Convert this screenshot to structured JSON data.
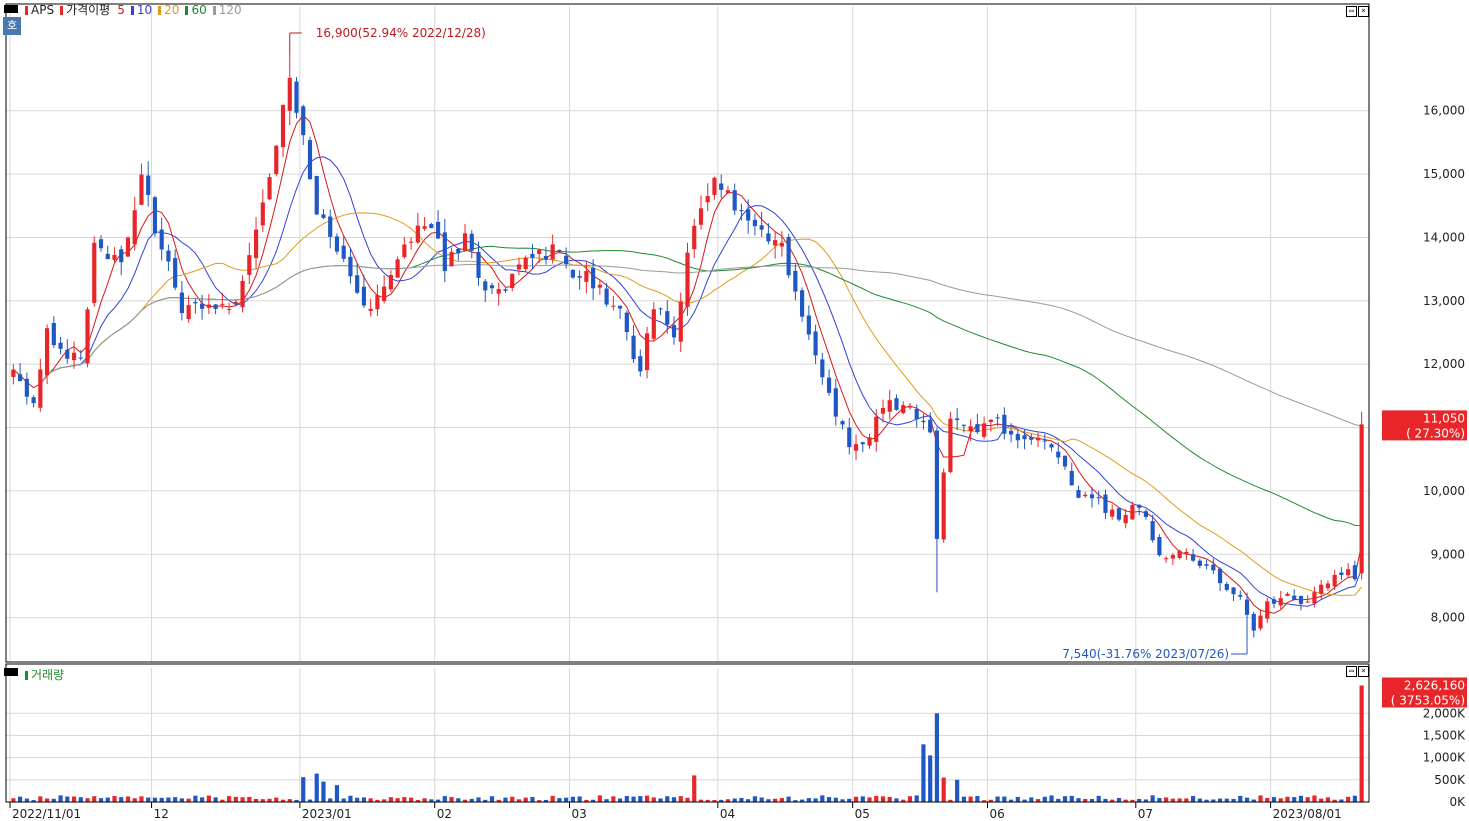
{
  "legend_price": {
    "ticker": "APS",
    "label": "가격이평",
    "ma5": "5",
    "ma10": "10",
    "ma20": "20",
    "ma60": "60",
    "ma120": "120"
  },
  "legend_volume": {
    "label": "거래량"
  },
  "side_tag": "호",
  "annotations": {
    "high": "16,900(52.94% 2022/12/28)",
    "low": "7,540(-31.76% 2023/07/26)"
  },
  "price_badge": {
    "price": "11,050",
    "change": "( 27.30%)"
  },
  "volume_badge": {
    "volume": "2,626,160",
    "change": "( 3753.05%)"
  },
  "colors": {
    "up": "#e8262a",
    "down": "#1f57c4",
    "ma5": "#d81818",
    "ma10": "#3340d8",
    "ma20": "#e39a1a",
    "ma60": "#1e8a2e",
    "ma120": "#9a9a9a",
    "grid": "#d8d8d8"
  },
  "chart_data": {
    "type": "candlestick",
    "x_axis_labels": [
      "2022/11/01",
      "12",
      "2023/01",
      "02",
      "03",
      "04",
      "05",
      "06",
      "07",
      "2023/08/01"
    ],
    "price_axis": {
      "ticks": [
        "8,000",
        "9,000",
        "10,000",
        "11,000",
        "12,000",
        "13,000",
        "14,000",
        "15,000",
        "16,000"
      ],
      "range": [
        7300,
        17400
      ]
    },
    "volume_axis": {
      "ticks": [
        "0K",
        "500K",
        "1,000K",
        "1,500K",
        "2,000K"
      ],
      "range": [
        0,
        2750000
      ]
    },
    "month_starts": [
      {
        "label": "2022/11/01",
        "index": 0
      },
      {
        "label": "12",
        "index": 21
      },
      {
        "label": "2023/01",
        "index": 43
      },
      {
        "label": "02",
        "index": 63
      },
      {
        "label": "03",
        "index": 83
      },
      {
        "label": "04",
        "index": 105
      },
      {
        "label": "05",
        "index": 125
      },
      {
        "label": "06",
        "index": 145
      },
      {
        "label": "07",
        "index": 167
      },
      {
        "label": "2023/08/01",
        "index": 187
      }
    ],
    "close_anchors": [
      [
        0,
        11800
      ],
      [
        3,
        11400
      ],
      [
        5,
        12500
      ],
      [
        10,
        12000
      ],
      [
        12,
        13900
      ],
      [
        16,
        13500
      ],
      [
        19,
        14900
      ],
      [
        22,
        13800
      ],
      [
        25,
        12900
      ],
      [
        28,
        13000
      ],
      [
        33,
        13000
      ],
      [
        37,
        14500
      ],
      [
        41,
        16500
      ],
      [
        42,
        16000
      ],
      [
        45,
        14500
      ],
      [
        48,
        13900
      ],
      [
        51,
        13100
      ],
      [
        53,
        12900
      ],
      [
        56,
        13500
      ],
      [
        59,
        14000
      ],
      [
        62,
        14200
      ],
      [
        64,
        13600
      ],
      [
        67,
        14000
      ],
      [
        70,
        13100
      ],
      [
        73,
        13200
      ],
      [
        77,
        13700
      ],
      [
        80,
        13800
      ],
      [
        83,
        13500
      ],
      [
        86,
        13300
      ],
      [
        90,
        12800
      ],
      [
        93,
        11900
      ],
      [
        95,
        12900
      ],
      [
        98,
        12500
      ],
      [
        101,
        14200
      ],
      [
        104,
        14900
      ],
      [
        107,
        14500
      ],
      [
        110,
        14300
      ],
      [
        114,
        13800
      ],
      [
        117,
        12800
      ],
      [
        121,
        11500
      ],
      [
        124,
        10700
      ],
      [
        127,
        10900
      ],
      [
        130,
        11400
      ],
      [
        133,
        11300
      ],
      [
        136,
        11000
      ],
      [
        137,
        9200
      ],
      [
        139,
        11200
      ],
      [
        142,
        11000
      ],
      [
        145,
        11100
      ],
      [
        149,
        10900
      ],
      [
        152,
        10800
      ],
      [
        155,
        10500
      ],
      [
        158,
        9900
      ],
      [
        161,
        9800
      ],
      [
        164,
        9600
      ],
      [
        167,
        9800
      ],
      [
        170,
        9000
      ],
      [
        174,
        9000
      ],
      [
        178,
        8700
      ],
      [
        182,
        8300
      ],
      [
        184,
        7800
      ],
      [
        186,
        8200
      ],
      [
        189,
        8300
      ],
      [
        192,
        8200
      ],
      [
        195,
        8600
      ],
      [
        198,
        8700
      ],
      [
        199,
        8680
      ],
      [
        200,
        11050
      ]
    ],
    "high": {
      "value": 16900,
      "date": "2022/12/28",
      "change_pct": 52.94
    },
    "low": {
      "value": 7540,
      "date": "2023/07/26",
      "change_pct": -31.76
    },
    "last_close": 11050,
    "last_change_pct": 27.3,
    "last_volume": 2626160,
    "last_volume_change_pct": 3753.05,
    "volume_spikes": [
      [
        43,
        560000
      ],
      [
        45,
        640000
      ],
      [
        46,
        460000
      ],
      [
        48,
        380000
      ],
      [
        135,
        1300000
      ],
      [
        136,
        1050000
      ],
      [
        137,
        2000000
      ],
      [
        138,
        550000
      ],
      [
        140,
        500000
      ],
      [
        101,
        600000
      ],
      [
        200,
        2626160
      ]
    ],
    "moving_averages": [
      5,
      10,
      20,
      60,
      120
    ]
  }
}
